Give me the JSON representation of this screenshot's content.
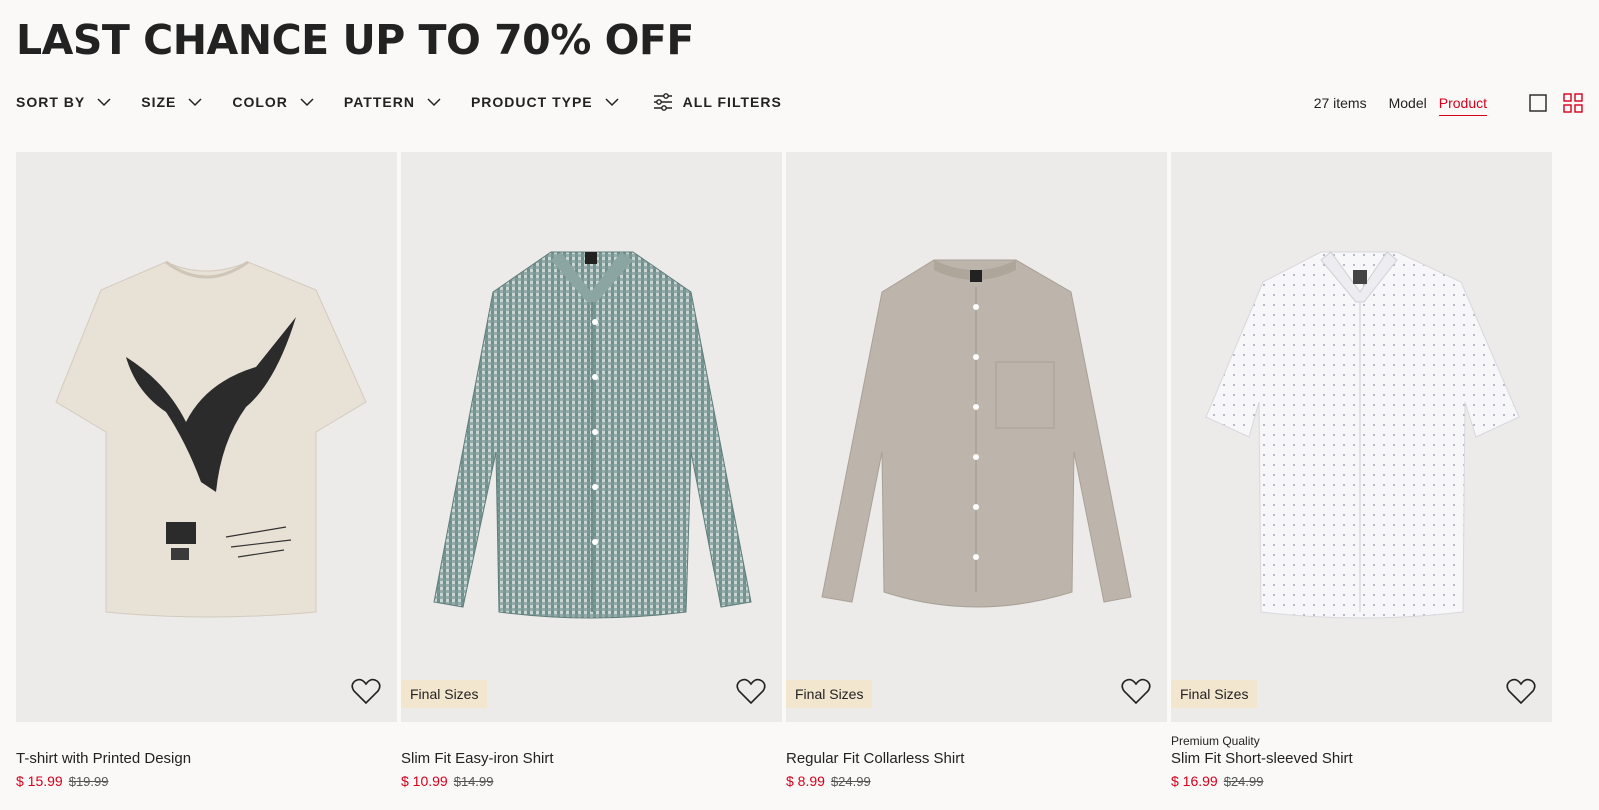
{
  "page": {
    "title": "LAST CHANCE UP TO 70% OFF"
  },
  "filters": [
    {
      "label": "SORT BY"
    },
    {
      "label": "SIZE"
    },
    {
      "label": "COLOR"
    },
    {
      "label": "PATTERN"
    },
    {
      "label": "PRODUCT TYPE"
    }
  ],
  "all_filters_label": "ALL FILTERS",
  "results": {
    "count": "27 items",
    "view_model": "Model",
    "view_product": "Product"
  },
  "colors": {
    "sale": "#d6001c",
    "badge_bg": "#f3e6cf",
    "image_bg": "#ecebe9"
  },
  "products": [
    {
      "subtitle": "",
      "name": "T-shirt with Printed Design",
      "price": "$ 15.99",
      "old_price": "$19.99",
      "badge": "",
      "icon": "heart-icon"
    },
    {
      "subtitle": "",
      "name": "Slim Fit Easy-iron Shirt",
      "price": "$ 10.99",
      "old_price": "$14.99",
      "badge": "Final Sizes",
      "icon": "heart-icon"
    },
    {
      "subtitle": "",
      "name": "Regular Fit Collarless Shirt",
      "price": "$ 8.99",
      "old_price": "$24.99",
      "badge": "Final Sizes",
      "icon": "heart-icon"
    },
    {
      "subtitle": "Premium Quality",
      "name": "Slim Fit Short-sleeved Shirt",
      "price": "$ 16.99",
      "old_price": "$24.99",
      "badge": "Final Sizes",
      "icon": "heart-icon"
    }
  ]
}
